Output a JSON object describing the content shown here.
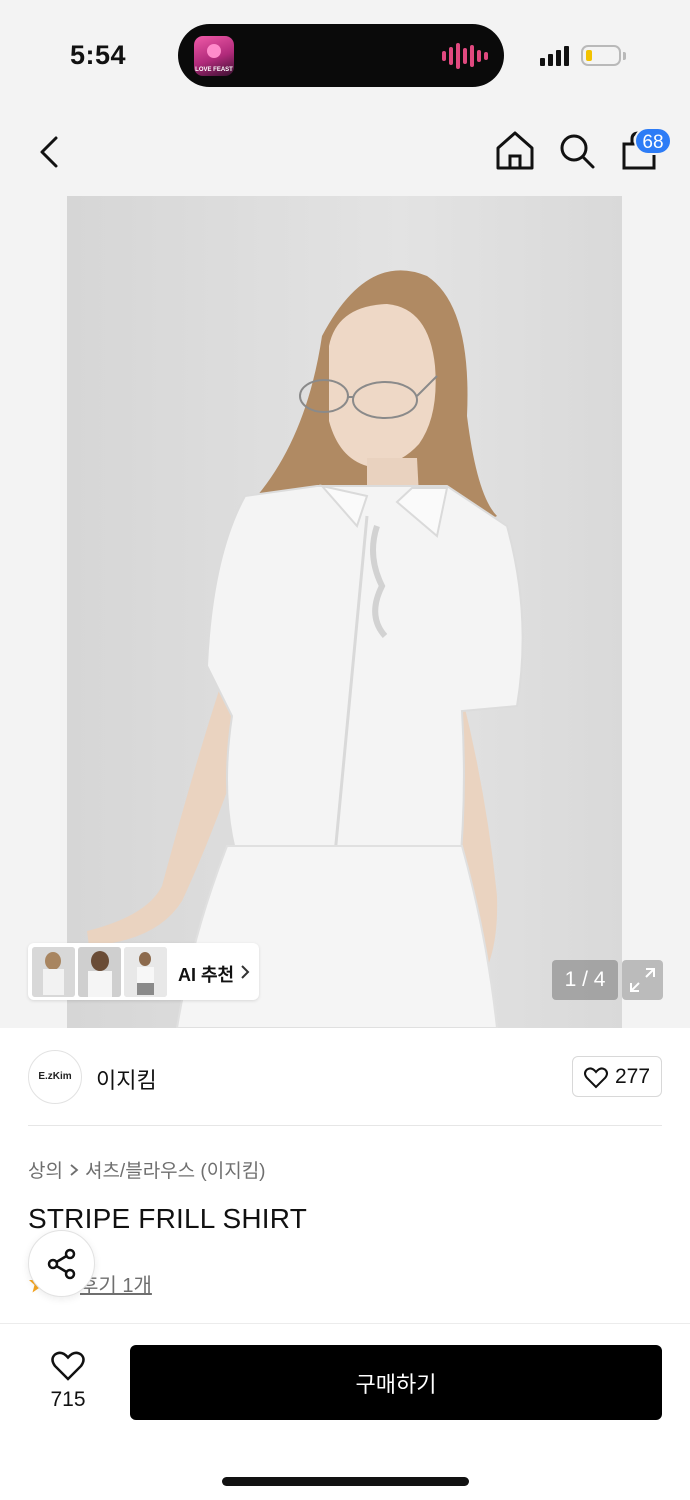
{
  "status_bar": {
    "time": "5:54",
    "island_app_label": "LOVE FEAST"
  },
  "nav": {
    "cart_badge": "68"
  },
  "gallery": {
    "ai_label": "AI 추천",
    "page_counter": "1 / 4",
    "current_page": 1,
    "total_pages": 4
  },
  "brand": {
    "logo_text": "E.zKim",
    "name": "이지킴",
    "like_count": "277"
  },
  "product": {
    "breadcrumb": [
      "상의",
      "셔츠/블라우스 (이지킴)"
    ],
    "title": "STRIPE FRILL SHIRT",
    "review_link": "후기 1개"
  },
  "bottom_bar": {
    "wish_count": "715",
    "buy_label": "구매하기"
  },
  "colors": {
    "badge": "#2d7cf6",
    "buy_button": "#000000",
    "page_bg": "#f3f3f3"
  }
}
